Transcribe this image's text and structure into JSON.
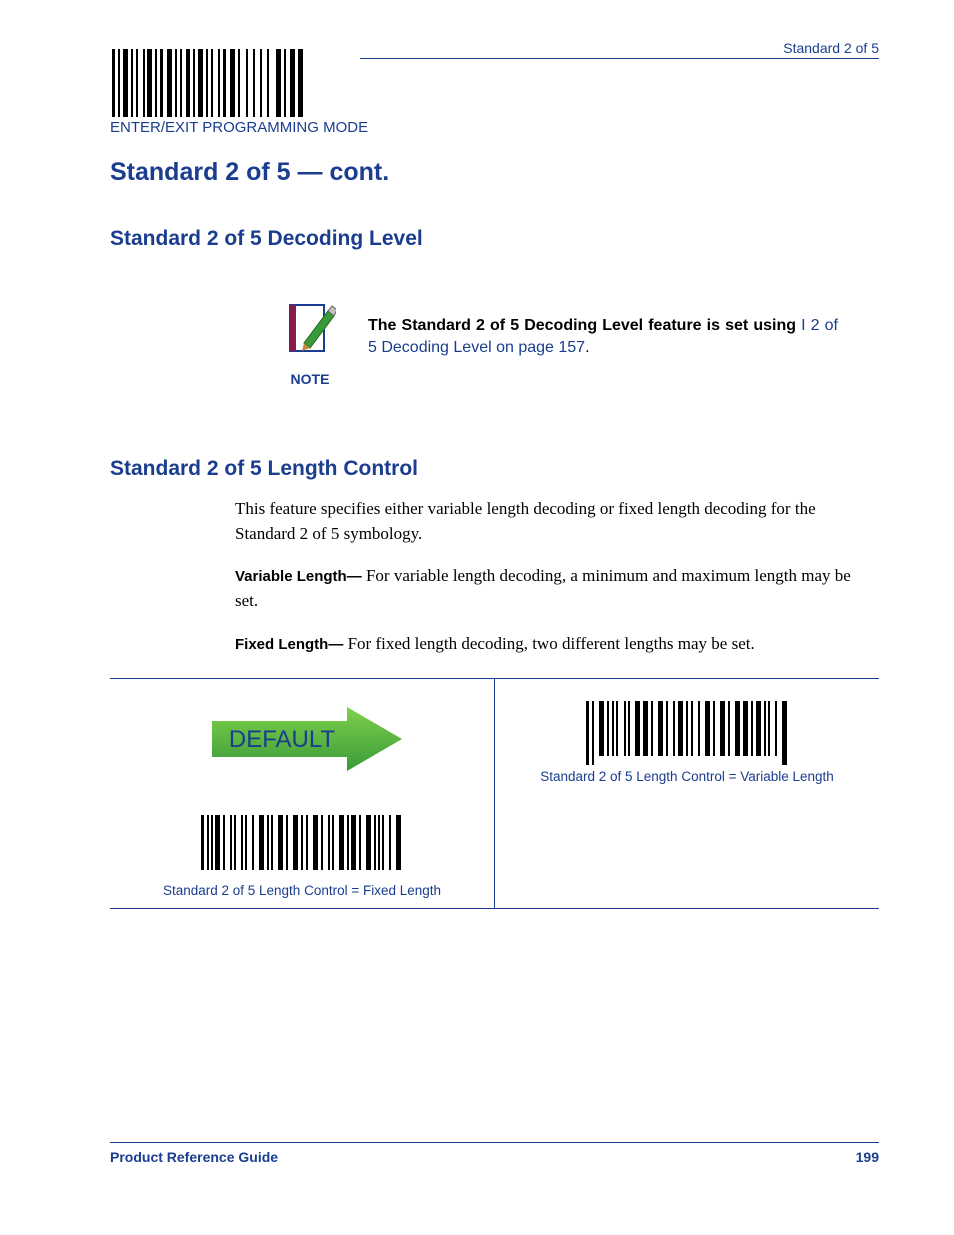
{
  "header": {
    "right_text": "Standard 2 of 5"
  },
  "top_barcode": {
    "label": "ENTER/EXIT PROGRAMMING MODE"
  },
  "h1": "Standard 2 of 5 — cont.",
  "section1": {
    "heading": "Standard 2 of 5 Decoding Level",
    "note_caption": "NOTE",
    "note_bold": "The Standard 2 of 5 Decoding Level feature is set using ",
    "note_link": "I 2 of 5 Decoding Level on page 157",
    "note_tail": "."
  },
  "section2": {
    "heading": "Standard 2 of 5 Length Control",
    "intro": "This feature specifies either variable length decoding or fixed length decoding for the Standard 2 of 5 symbology.",
    "variable_label": "Variable Length—",
    "variable_text": " For variable length decoding, a minimum and maximum length may be set.",
    "fixed_label": "Fixed Length—",
    "fixed_text": " For fixed length decoding, two different lengths may be set."
  },
  "table": {
    "default_label": "DEFAULT",
    "variable_caption": "Standard 2 of 5 Length Control = Variable Length",
    "fixed_caption": "Standard 2 of 5 Length Control = Fixed Length"
  },
  "footer": {
    "left": "Product Reference Guide",
    "right": "199"
  }
}
